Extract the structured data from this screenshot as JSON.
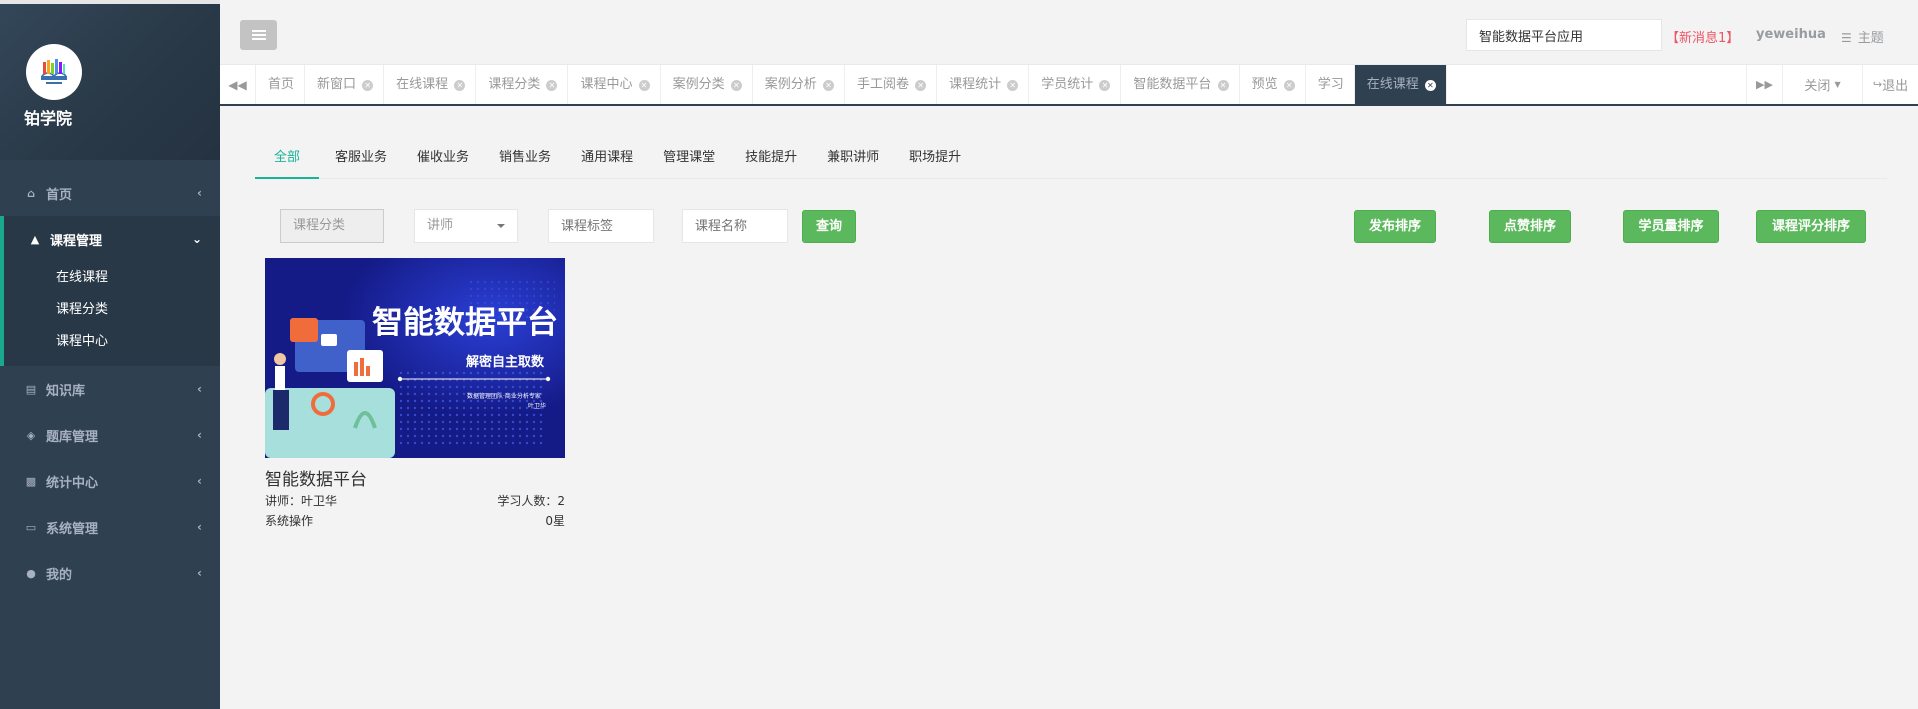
{
  "brand": {
    "name": "铂学院"
  },
  "sidebar": {
    "items": [
      {
        "label": "首页",
        "icon": "home-icon"
      },
      {
        "label": "课程管理",
        "icon": "graduation-cap-icon",
        "children": [
          "在线课程",
          "课程分类",
          "课程中心"
        ]
      },
      {
        "label": "知识库",
        "icon": "book-icon"
      },
      {
        "label": "题库管理",
        "icon": "cube-icon"
      },
      {
        "label": "统计中心",
        "icon": "bar-chart-icon"
      },
      {
        "label": "系统管理",
        "icon": "desktop-icon"
      },
      {
        "label": "我的",
        "icon": "user-icon"
      }
    ]
  },
  "topbar": {
    "search_value": "智能数据平台应用",
    "new_message": "【新消息1】",
    "username": "yeweihua",
    "theme_label": "主题"
  },
  "tabs": {
    "items": [
      "首页",
      "新窗口",
      "在线课程",
      "课程分类",
      "课程中心",
      "案例分类",
      "案例分析",
      "手工阅卷",
      "课程统计",
      "学员统计",
      "智能数据平台",
      "预览",
      "学习",
      "在线课程"
    ],
    "close_label": "关闭",
    "logout_label": "退出"
  },
  "categories": [
    "全部",
    "客服业务",
    "催收业务",
    "销售业务",
    "通用课程",
    "管理课堂",
    "技能提升",
    "兼职讲师",
    "职场提升"
  ],
  "filters": {
    "category_placeholder": "课程分类",
    "teacher_selected": "讲师",
    "tag_placeholder": "课程标签",
    "name_placeholder": "课程名称",
    "query_label": "查询"
  },
  "sort_buttons": [
    "发布排序",
    "点赞排序",
    "学员量排序",
    "课程评分排序"
  ],
  "course": {
    "banner_title": "智能数据平台",
    "banner_subtitle": "解密自主取数",
    "banner_author_line1": "数据管理团队·商业分析专家",
    "banner_author_line2": "叶卫华",
    "title": "智能数据平台",
    "teacher": "讲师：叶卫华",
    "students": "学习人数：2",
    "category": "系统操作",
    "rating": "0星"
  },
  "colors": {
    "sidebar_bg": "#2f4050",
    "accent_green": "#1ab394",
    "button_green": "#5cb85c",
    "alert_red": "#ed5565"
  }
}
